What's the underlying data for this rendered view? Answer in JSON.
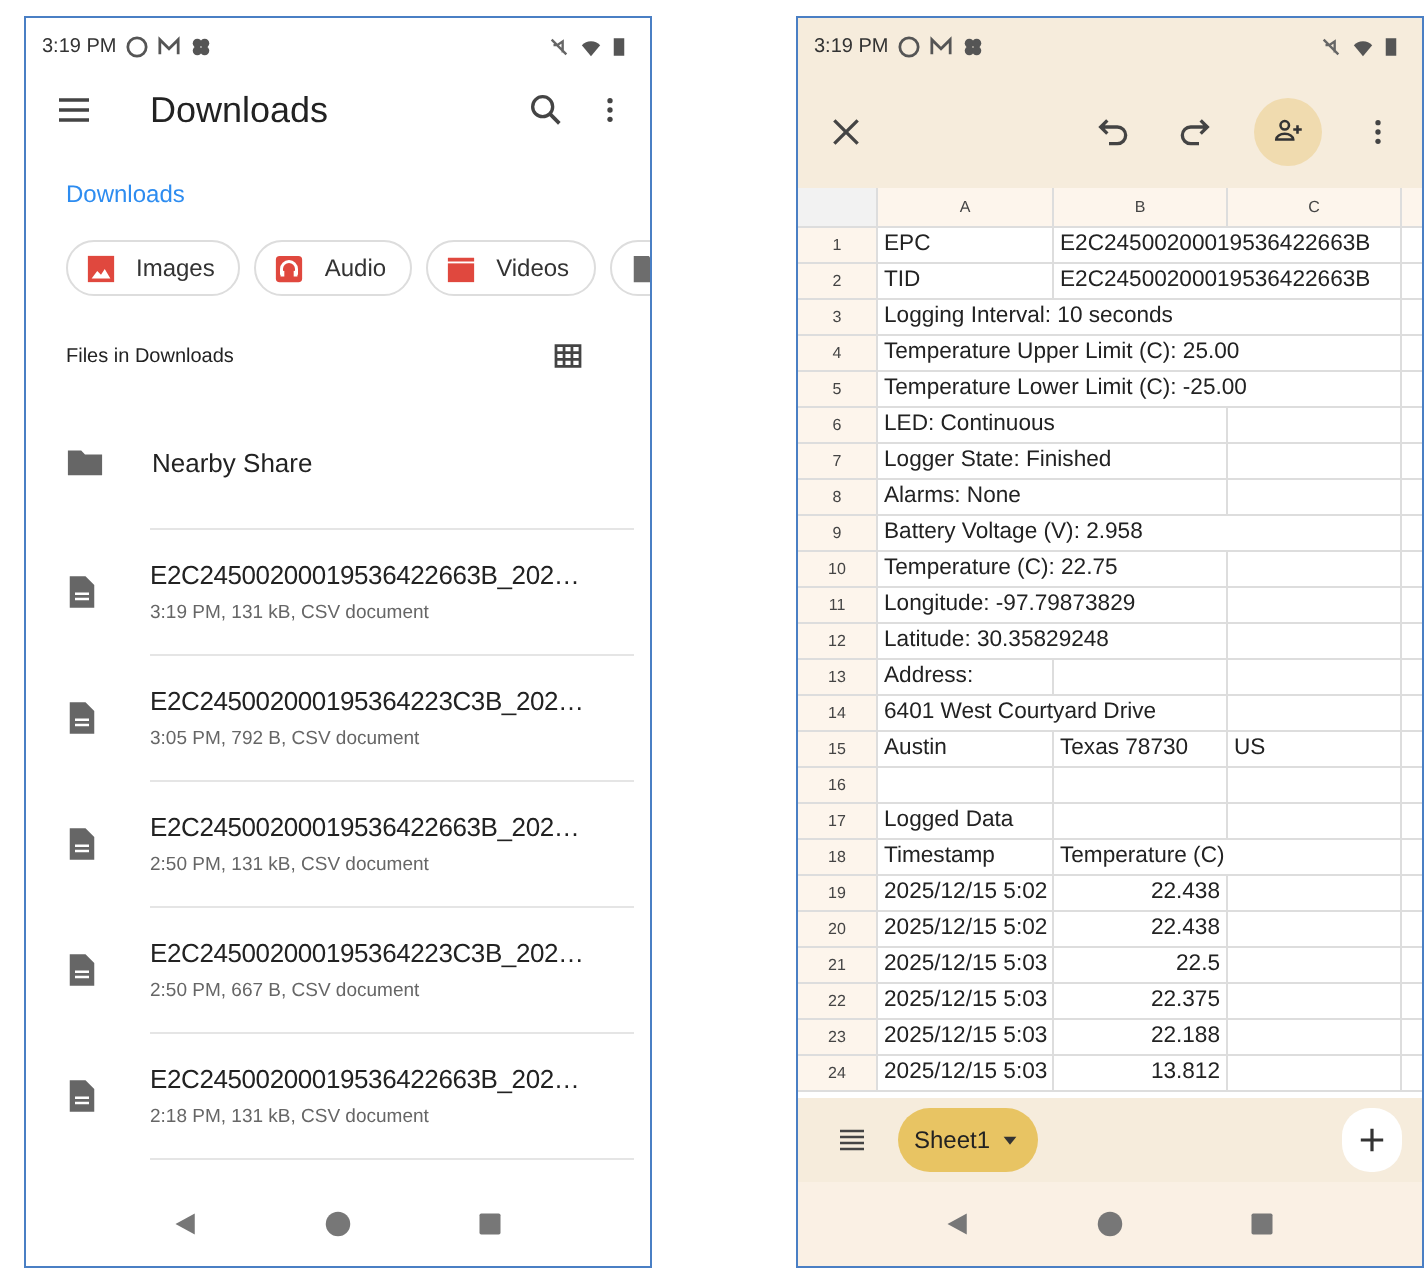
{
  "file_manager": {
    "status_bar": {
      "time": "3:19 PM"
    },
    "title": "Downloads",
    "breadcrumb": "Downloads",
    "chips": [
      {
        "kind": "images",
        "label": "Images"
      },
      {
        "kind": "audio",
        "label": "Audio"
      },
      {
        "kind": "videos",
        "label": "Videos"
      },
      {
        "kind": "documents"
      }
    ],
    "section_title": "Files in Downloads",
    "folders": [
      {
        "name": "Nearby Share"
      }
    ],
    "files": [
      {
        "name": "E2C24500200019536422663B_202…",
        "details": "3:19 PM, 131 kB, CSV document"
      },
      {
        "name": "E2C245002000195364223C3B_202…",
        "details": "3:05 PM, 792 B, CSV document"
      },
      {
        "name": "E2C24500200019536422663B_202…",
        "details": "2:50 PM, 131 kB, CSV document"
      },
      {
        "name": "E2C245002000195364223C3B_202…",
        "details": "2:50 PM, 667 B, CSV document"
      },
      {
        "name": "E2C24500200019536422663B_202…",
        "details": "2:18 PM, 131 kB, CSV document"
      }
    ]
  },
  "spreadsheet": {
    "status_bar": {
      "time": "3:19 PM"
    },
    "columns": [
      "A",
      "B",
      "C"
    ],
    "rows": [
      {
        "number": "1",
        "cells": {
          "A": "EPC",
          "B": "E2C24500200019536422663B"
        }
      },
      {
        "number": "2",
        "cells": {
          "A": "TID",
          "B": "E2C24500200019536422663B"
        }
      },
      {
        "number": "3",
        "cells": {
          "A": "Logging Interval: 10 seconds"
        }
      },
      {
        "number": "4",
        "cells": {
          "A": "Temperature Upper Limit (C): 25.00"
        }
      },
      {
        "number": "5",
        "cells": {
          "A": "Temperature Lower Limit (C): -25.00"
        }
      },
      {
        "number": "6",
        "cells": {
          "A": "LED: Continuous"
        }
      },
      {
        "number": "7",
        "cells": {
          "A": "Logger State: Finished"
        }
      },
      {
        "number": "8",
        "cells": {
          "A": "Alarms: None"
        }
      },
      {
        "number": "9",
        "cells": {
          "A": "Battery Voltage (V): 2.958"
        }
      },
      {
        "number": "10",
        "cells": {
          "A": "Temperature (C): 22.75"
        }
      },
      {
        "number": "11",
        "cells": {
          "A": "Longitude: -97.79873829"
        }
      },
      {
        "number": "12",
        "cells": {
          "A": "Latitude: 30.35829248"
        }
      },
      {
        "number": "13",
        "cells": {
          "A": "Address:"
        }
      },
      {
        "number": "14",
        "cells": {
          "A": "6401 West Courtyard Drive"
        }
      },
      {
        "number": "15",
        "cells": {
          "A": "Austin",
          "B": "Texas 78730",
          "C": "US"
        }
      },
      {
        "number": "16",
        "cells": {}
      },
      {
        "number": "17",
        "cells": {
          "A": "Logged Data"
        }
      },
      {
        "number": "18",
        "cells": {
          "A": "Timestamp",
          "B": "Temperature (C)"
        }
      },
      {
        "number": "19",
        "kind": "data",
        "cells": {
          "A": "2025/12/15 5:02",
          "B": "22.438"
        }
      },
      {
        "number": "20",
        "kind": "data",
        "cells": {
          "A": "2025/12/15 5:02",
          "B": "22.438"
        }
      },
      {
        "number": "21",
        "kind": "data",
        "cells": {
          "A": "2025/12/15 5:03",
          "B": "22.5"
        }
      },
      {
        "number": "22",
        "kind": "data",
        "cells": {
          "A": "2025/12/15 5:03",
          "B": "22.375"
        }
      },
      {
        "number": "23",
        "kind": "data",
        "cells": {
          "A": "2025/12/15 5:03",
          "B": "22.188"
        }
      },
      {
        "number": "24",
        "kind": "data",
        "cells": {
          "A": "2025/12/15 5:03",
          "B": "13.812"
        }
      }
    ],
    "sheet_tabs": [
      {
        "label": "Sheet1",
        "selected": true
      }
    ]
  }
}
